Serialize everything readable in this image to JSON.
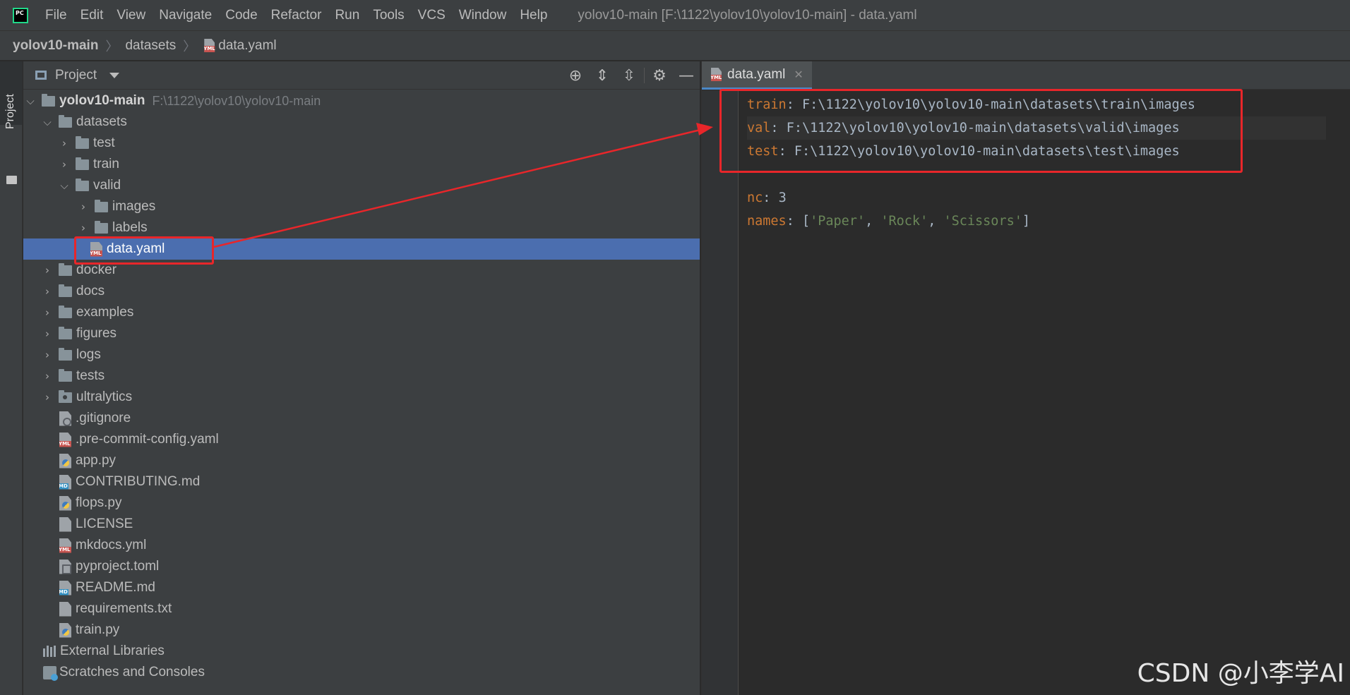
{
  "menubar": {
    "items": [
      {
        "label": "File"
      },
      {
        "label": "Edit"
      },
      {
        "label": "View"
      },
      {
        "label": "Navigate"
      },
      {
        "label": "Code"
      },
      {
        "label": "Refactor"
      },
      {
        "label": "Run"
      },
      {
        "label": "Tools"
      },
      {
        "label": "VCS"
      },
      {
        "label": "Window"
      },
      {
        "label": "Help"
      }
    ],
    "window_title": "yolov10-main [F:\\1122\\yolov10\\yolov10-main] - data.yaml"
  },
  "breadcrumb": {
    "items": [
      "yolov10-main",
      "datasets",
      "data.yaml"
    ]
  },
  "tool_strip": {
    "label": "Project"
  },
  "project_panel": {
    "title": "Project",
    "tools": [
      "locate-icon",
      "expand-all-icon",
      "collapse-all-icon",
      "gear-icon",
      "minimize-icon"
    ],
    "root": {
      "label": "yolov10-main",
      "path": "F:\\1122\\yolov10\\yolov10-main"
    },
    "tree": [
      {
        "label": "datasets"
      },
      {
        "label": "test"
      },
      {
        "label": "train"
      },
      {
        "label": "valid"
      },
      {
        "label": "images"
      },
      {
        "label": "labels"
      },
      {
        "label": "data.yaml"
      },
      {
        "label": "docker"
      },
      {
        "label": "docs"
      },
      {
        "label": "examples"
      },
      {
        "label": "figures"
      },
      {
        "label": "logs"
      },
      {
        "label": "tests"
      },
      {
        "label": "ultralytics"
      },
      {
        "label": ".gitignore"
      },
      {
        "label": ".pre-commit-config.yaml"
      },
      {
        "label": "app.py"
      },
      {
        "label": "CONTRIBUTING.md"
      },
      {
        "label": "flops.py"
      },
      {
        "label": "LICENSE"
      },
      {
        "label": "mkdocs.yml"
      },
      {
        "label": "pyproject.toml"
      },
      {
        "label": "README.md"
      },
      {
        "label": "requirements.txt"
      },
      {
        "label": "train.py"
      },
      {
        "label": "External Libraries"
      },
      {
        "label": "Scratches and Consoles"
      }
    ]
  },
  "editor": {
    "tab_label": "data.yaml",
    "lines": [
      {
        "key": "train",
        "colon": ":",
        "value": "F:\\1122\\yolov10\\yolov10-main\\datasets\\train\\images"
      },
      {
        "key": "val",
        "colon": ":",
        "value": "F:\\1122\\yolov10\\yolov10-main\\datasets\\valid\\images"
      },
      {
        "key": "test",
        "colon": ":",
        "value": "F:\\1122\\yolov10\\yolov10-main\\datasets\\test\\images"
      },
      {
        "key": "",
        "colon": "",
        "value": ""
      },
      {
        "key": "nc",
        "colon": ":",
        "value": "3"
      },
      {
        "key": "names",
        "colon": ":",
        "open": "[",
        "items": [
          "'Paper'",
          "'Rock'",
          "'Scissors'"
        ],
        "sep": ", ",
        "close": "]"
      }
    ]
  },
  "watermark": "CSDN @小李学AI",
  "colors": {
    "accent_red": "#e8262a",
    "selection": "#4b6eaf",
    "yaml_key": "#cc7832",
    "yaml_string": "#6a8759"
  }
}
